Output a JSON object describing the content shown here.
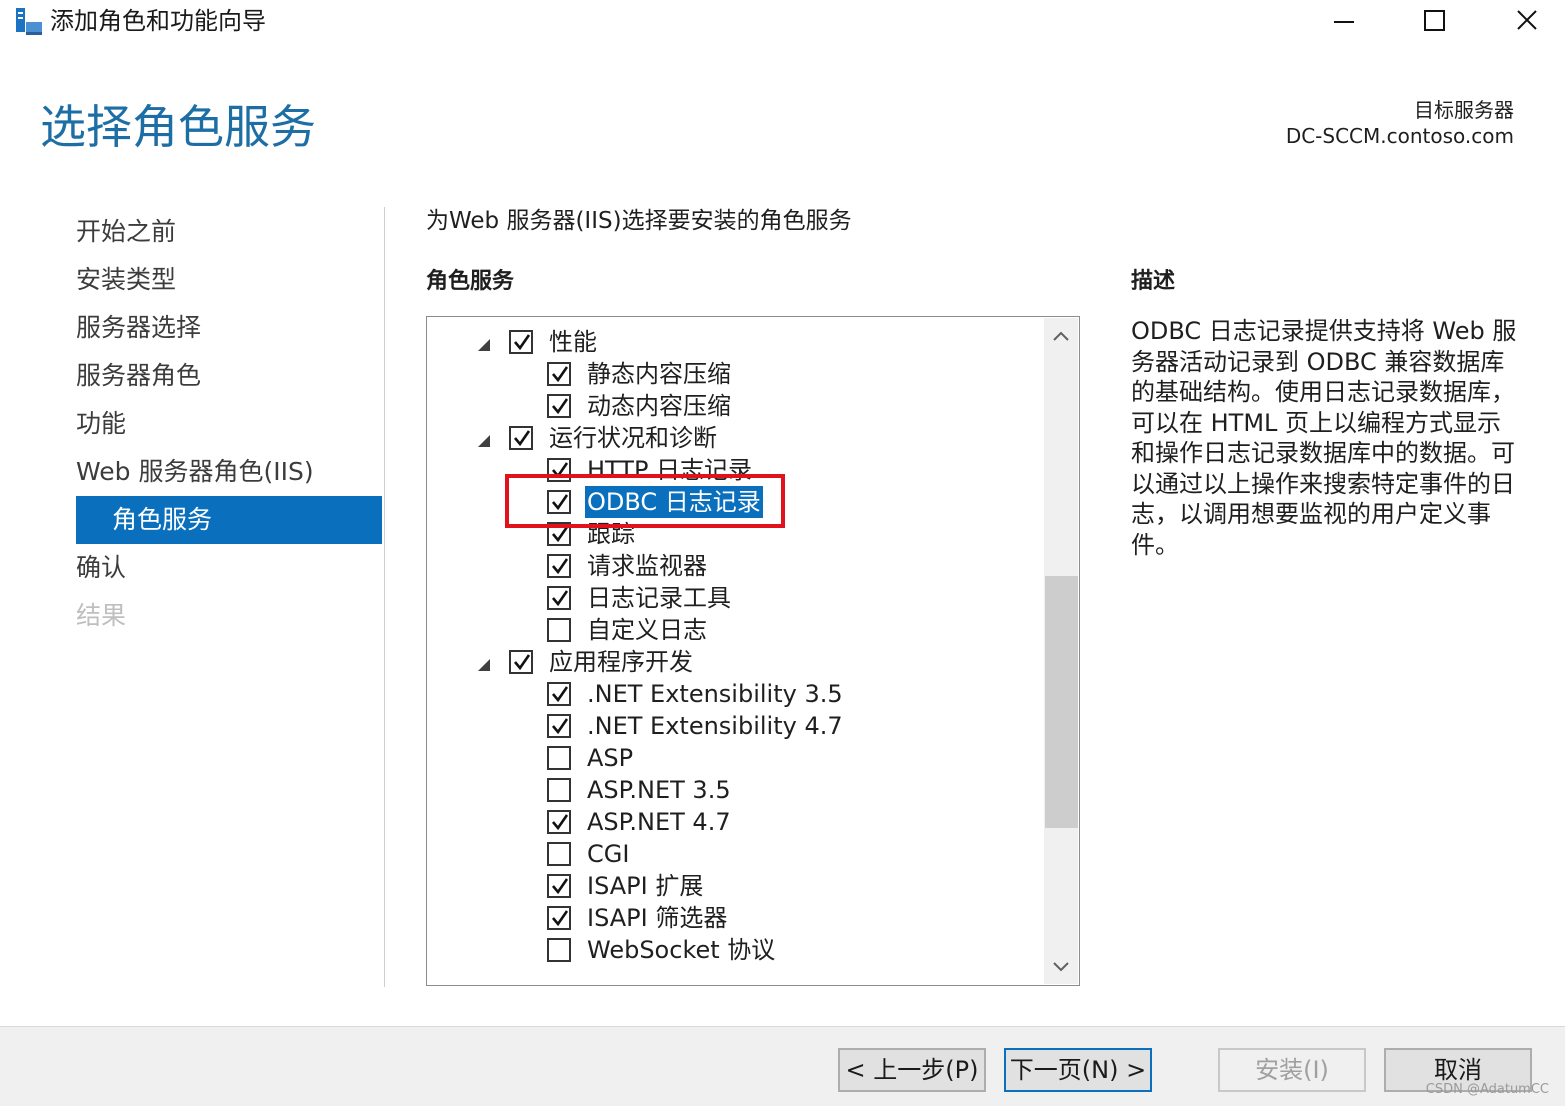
{
  "window": {
    "title": "添加角色和功能向导",
    "controls": {
      "minimize": "minimize-icon",
      "maximize": "maximize-icon",
      "close": "close-icon"
    }
  },
  "page": {
    "title": "选择角色服务",
    "target_label": "目标服务器",
    "target_server": "DC-SCCM.contoso.com"
  },
  "nav": {
    "items": [
      {
        "label": "开始之前",
        "state": "normal"
      },
      {
        "label": "安装类型",
        "state": "normal"
      },
      {
        "label": "服务器选择",
        "state": "normal"
      },
      {
        "label": "服务器角色",
        "state": "normal"
      },
      {
        "label": "功能",
        "state": "normal"
      },
      {
        "label": "Web 服务器角色(IIS)",
        "state": "normal"
      },
      {
        "label": "角色服务",
        "state": "active"
      },
      {
        "label": "确认",
        "state": "normal"
      },
      {
        "label": "结果",
        "state": "disabled"
      }
    ]
  },
  "main": {
    "instruction": "为Web 服务器(IIS)选择要安装的角色服务",
    "role_services_heading": "角色服务",
    "tree": [
      {
        "label": "性能",
        "checked": true,
        "level": 0,
        "expanded": true
      },
      {
        "label": "静态内容压缩",
        "checked": true,
        "level": 1
      },
      {
        "label": "动态内容压缩",
        "checked": true,
        "level": 1
      },
      {
        "label": "运行状况和诊断",
        "checked": true,
        "level": 0,
        "expanded": true
      },
      {
        "label": "HTTP 日志记录",
        "checked": true,
        "level": 1
      },
      {
        "label": "ODBC 日志记录",
        "checked": true,
        "level": 1,
        "selected": true
      },
      {
        "label": "跟踪",
        "checked": true,
        "level": 1
      },
      {
        "label": "请求监视器",
        "checked": true,
        "level": 1
      },
      {
        "label": "日志记录工具",
        "checked": true,
        "level": 1
      },
      {
        "label": "自定义日志",
        "checked": false,
        "level": 1
      },
      {
        "label": "应用程序开发",
        "checked": true,
        "level": 0,
        "expanded": true
      },
      {
        "label": ".NET Extensibility 3.5",
        "checked": true,
        "level": 1
      },
      {
        "label": ".NET Extensibility 4.7",
        "checked": true,
        "level": 1
      },
      {
        "label": "ASP",
        "checked": false,
        "level": 1
      },
      {
        "label": "ASP.NET 3.5",
        "checked": false,
        "level": 1
      },
      {
        "label": "ASP.NET 4.7",
        "checked": true,
        "level": 1
      },
      {
        "label": "CGI",
        "checked": false,
        "level": 1
      },
      {
        "label": "ISAPI 扩展",
        "checked": true,
        "level": 1
      },
      {
        "label": "ISAPI 筛选器",
        "checked": true,
        "level": 1
      },
      {
        "label": "WebSocket 协议",
        "checked": false,
        "level": 1
      }
    ]
  },
  "description": {
    "heading": "描述",
    "text": "ODBC 日志记录提供支持将 Web 服务器活动记录到 ODBC 兼容数据库的基础结构。使用日志记录数据库，可以在 HTML 页上以编程方式显示和操作日志记录数据库中的数据。可以通过以上操作来搜索特定事件的日志，以调用想要监视的用户定义事件。"
  },
  "footer": {
    "prev": "< 上一步(P)",
    "next": "下一页(N) >",
    "install": "安装(I)",
    "cancel": "取消"
  },
  "watermark": "CSDN @AdatumCC",
  "colors": {
    "accent": "#0a6fbd",
    "title": "#1e6ea6",
    "highlight": "#e1121b"
  }
}
